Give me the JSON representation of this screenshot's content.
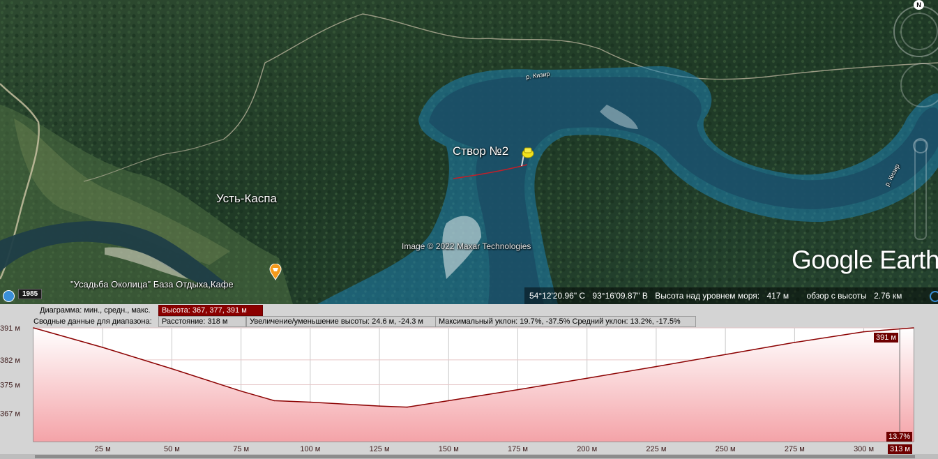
{
  "map": {
    "places": {
      "ust_kaspa": "Усть-Каспа",
      "stvor": "Створ №2",
      "usadba": "\"Усадьба Околица\"  База Отдыха,Кафе"
    },
    "river_labels": [
      "р. Кизир",
      "р. Кизир"
    ],
    "attribution": "Image © 2022 Maxar Technologies",
    "logo": "Google Earth",
    "north_label": "N",
    "icons": [
      "placemark-pin-icon",
      "poi-food-icon",
      "compass-icon",
      "history-clock-icon"
    ]
  },
  "statusbar": {
    "year": "1985",
    "lat": "54°12'20.96\" С",
    "lon": "93°16'09.87\" В",
    "elev_label": "Высота над уровнем моря:",
    "elev_value": "417 м",
    "eye_label": "обзор с высоты",
    "eye_value": "2.76 км"
  },
  "profile": {
    "row1_label": "Диаграмма: мин., средн., макс.",
    "row1_value": "Высота: 367, 377, 391 м",
    "row2_label": "Сводные данные для диапазона:",
    "distance": "Расстояние: 318 м",
    "gain_loss": "Увеличение/уменьшение высоты: 24.6 м, -24.3 м",
    "max_slope": "Максимальный уклон: 19.7%, -37.5%",
    "avg_slope": "Средний уклон: 13.2%, -17.5%",
    "flag_max": "391 м",
    "flag_slope": "13.7%",
    "flag_dist": "313 м",
    "colors": {
      "line": "#8b0000",
      "fill_top": "#ffffff",
      "fill_bottom": "#f4a3a8",
      "accent": "#8b0000"
    }
  },
  "chart_data": {
    "type": "area",
    "ylim": [
      359,
      391
    ],
    "xlim": [
      0,
      318
    ],
    "yticks": [
      {
        "value": 391,
        "label": "391 м"
      },
      {
        "value": 382,
        "label": "382 м"
      },
      {
        "value": 375,
        "label": "375 м"
      },
      {
        "value": 367,
        "label": "367 м"
      }
    ],
    "xticks": [
      {
        "value": 25,
        "label": "25 м"
      },
      {
        "value": 50,
        "label": "50 м"
      },
      {
        "value": 75,
        "label": "75 м"
      },
      {
        "value": 100,
        "label": "100 м"
      },
      {
        "value": 125,
        "label": "125 м"
      },
      {
        "value": 150,
        "label": "150 м"
      },
      {
        "value": 175,
        "label": "175 м"
      },
      {
        "value": 200,
        "label": "200 м"
      },
      {
        "value": 225,
        "label": "225 м"
      },
      {
        "value": 250,
        "label": "250 м"
      },
      {
        "value": 275,
        "label": "275 м"
      },
      {
        "value": 300,
        "label": "300 м"
      }
    ],
    "series": [
      {
        "x": [
          0,
          25,
          50,
          75,
          87,
          100,
          125,
          135,
          150,
          175,
          200,
          225,
          250,
          275,
          300,
          318
        ],
        "y": [
          391,
          385.5,
          379.5,
          373.2,
          370.5,
          370.1,
          369.0,
          368.7,
          370.5,
          373.6,
          376.8,
          380.1,
          383.5,
          386.9,
          389.9,
          391
        ]
      }
    ],
    "grid": true
  }
}
